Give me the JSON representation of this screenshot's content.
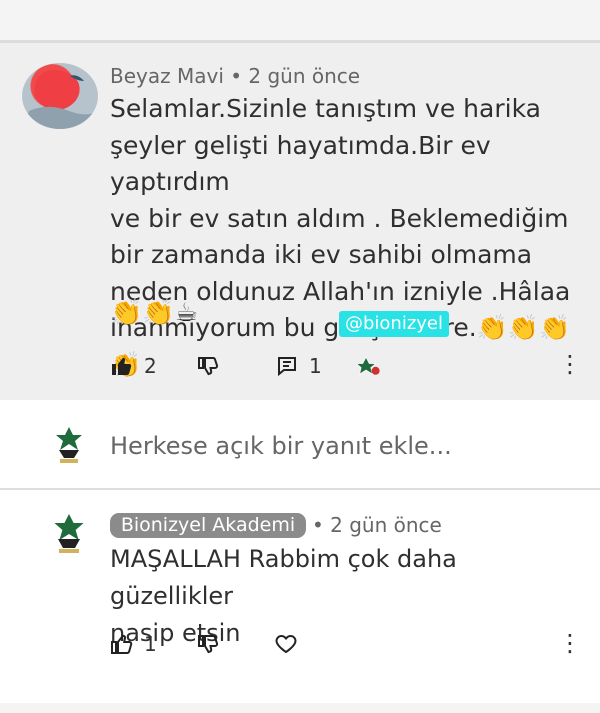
{
  "comment": {
    "author": "Beyaz Mavi",
    "separator": "•",
    "time": "2 gün önce",
    "text": "Selamlar.Sizinle tanıştım ve harika\nşeyler gelişti hayatımda.Bir ev yaptırdım\nve bir ev satın aldım . Beklemediğim\nbir zamanda iki ev sahibi olmama\nneden oldunuz Allah'ın izniyle .Hâlaa\ninanmıyorum bu gelişmelere.👏👏👏👏",
    "emojis": "👏👏☕",
    "handle_badge": "@bionizyel",
    "likes": "2",
    "replies": "1"
  },
  "reply_box": {
    "placeholder": "Herkese açık bir yanıt ekle..."
  },
  "reply": {
    "author": "Bionizyel Akademi",
    "separator": "•",
    "time": "2 gün önce",
    "text": "MAŞALLAH  Rabbim çok daha güzellikler\nnasip etsin",
    "likes": "1"
  },
  "icons": {
    "like": "thumbs-up-icon",
    "dislike": "thumbs-down-icon",
    "reply": "comment-icon",
    "heart": "heart-icon",
    "menu": "more-vertical-icon"
  },
  "colors": {
    "badge": "#29e2e6",
    "chip": "#8b8b8b",
    "heart": "#d32f2f"
  }
}
